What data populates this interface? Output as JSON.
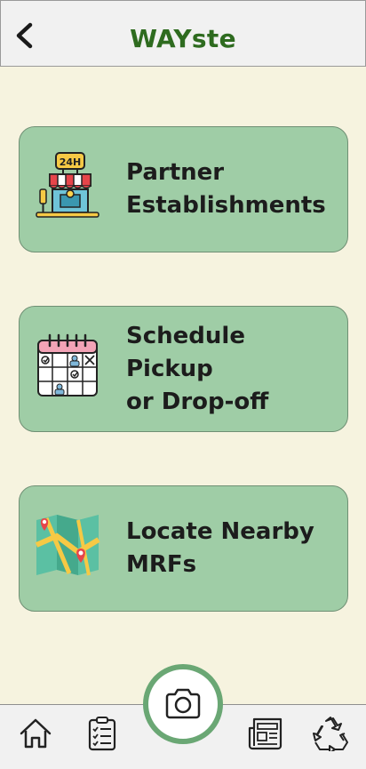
{
  "app": {
    "title": "WAYste"
  },
  "header": {
    "back_icon": "chevron-left-icon"
  },
  "cards": [
    {
      "label": "Partner\nEstablishments",
      "icon": "store-24h-icon"
    },
    {
      "label": "Schedule Pickup\nor Drop-off",
      "icon": "calendar-icon"
    },
    {
      "label": "Locate Nearby\nMRFs",
      "icon": "map-icon"
    }
  ],
  "nav": {
    "items": [
      {
        "icon": "home-icon"
      },
      {
        "icon": "checklist-icon"
      },
      {
        "icon": "camera-icon"
      },
      {
        "icon": "newspaper-icon"
      },
      {
        "icon": "recycle-icon"
      }
    ]
  },
  "colors": {
    "background": "#f6f3df",
    "card": "#9fcda6",
    "title": "#2e6b1f",
    "camera_ring": "#6aa774"
  },
  "store_sign": "24H"
}
